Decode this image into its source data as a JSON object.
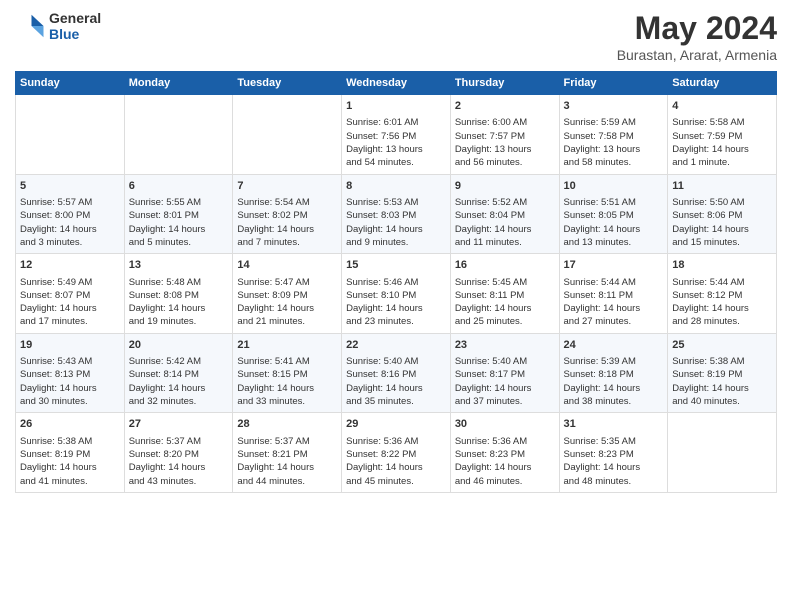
{
  "header": {
    "logo_general": "General",
    "logo_blue": "Blue",
    "title": "May 2024",
    "subtitle": "Burastan, Ararat, Armenia"
  },
  "calendar": {
    "days_of_week": [
      "Sunday",
      "Monday",
      "Tuesday",
      "Wednesday",
      "Thursday",
      "Friday",
      "Saturday"
    ],
    "weeks": [
      [
        {
          "day": "",
          "detail": ""
        },
        {
          "day": "",
          "detail": ""
        },
        {
          "day": "",
          "detail": ""
        },
        {
          "day": "1",
          "detail": "Sunrise: 6:01 AM\nSunset: 7:56 PM\nDaylight: 13 hours\nand 54 minutes."
        },
        {
          "day": "2",
          "detail": "Sunrise: 6:00 AM\nSunset: 7:57 PM\nDaylight: 13 hours\nand 56 minutes."
        },
        {
          "day": "3",
          "detail": "Sunrise: 5:59 AM\nSunset: 7:58 PM\nDaylight: 13 hours\nand 58 minutes."
        },
        {
          "day": "4",
          "detail": "Sunrise: 5:58 AM\nSunset: 7:59 PM\nDaylight: 14 hours\nand 1 minute."
        }
      ],
      [
        {
          "day": "5",
          "detail": "Sunrise: 5:57 AM\nSunset: 8:00 PM\nDaylight: 14 hours\nand 3 minutes."
        },
        {
          "day": "6",
          "detail": "Sunrise: 5:55 AM\nSunset: 8:01 PM\nDaylight: 14 hours\nand 5 minutes."
        },
        {
          "day": "7",
          "detail": "Sunrise: 5:54 AM\nSunset: 8:02 PM\nDaylight: 14 hours\nand 7 minutes."
        },
        {
          "day": "8",
          "detail": "Sunrise: 5:53 AM\nSunset: 8:03 PM\nDaylight: 14 hours\nand 9 minutes."
        },
        {
          "day": "9",
          "detail": "Sunrise: 5:52 AM\nSunset: 8:04 PM\nDaylight: 14 hours\nand 11 minutes."
        },
        {
          "day": "10",
          "detail": "Sunrise: 5:51 AM\nSunset: 8:05 PM\nDaylight: 14 hours\nand 13 minutes."
        },
        {
          "day": "11",
          "detail": "Sunrise: 5:50 AM\nSunset: 8:06 PM\nDaylight: 14 hours\nand 15 minutes."
        }
      ],
      [
        {
          "day": "12",
          "detail": "Sunrise: 5:49 AM\nSunset: 8:07 PM\nDaylight: 14 hours\nand 17 minutes."
        },
        {
          "day": "13",
          "detail": "Sunrise: 5:48 AM\nSunset: 8:08 PM\nDaylight: 14 hours\nand 19 minutes."
        },
        {
          "day": "14",
          "detail": "Sunrise: 5:47 AM\nSunset: 8:09 PM\nDaylight: 14 hours\nand 21 minutes."
        },
        {
          "day": "15",
          "detail": "Sunrise: 5:46 AM\nSunset: 8:10 PM\nDaylight: 14 hours\nand 23 minutes."
        },
        {
          "day": "16",
          "detail": "Sunrise: 5:45 AM\nSunset: 8:11 PM\nDaylight: 14 hours\nand 25 minutes."
        },
        {
          "day": "17",
          "detail": "Sunrise: 5:44 AM\nSunset: 8:11 PM\nDaylight: 14 hours\nand 27 minutes."
        },
        {
          "day": "18",
          "detail": "Sunrise: 5:44 AM\nSunset: 8:12 PM\nDaylight: 14 hours\nand 28 minutes."
        }
      ],
      [
        {
          "day": "19",
          "detail": "Sunrise: 5:43 AM\nSunset: 8:13 PM\nDaylight: 14 hours\nand 30 minutes."
        },
        {
          "day": "20",
          "detail": "Sunrise: 5:42 AM\nSunset: 8:14 PM\nDaylight: 14 hours\nand 32 minutes."
        },
        {
          "day": "21",
          "detail": "Sunrise: 5:41 AM\nSunset: 8:15 PM\nDaylight: 14 hours\nand 33 minutes."
        },
        {
          "day": "22",
          "detail": "Sunrise: 5:40 AM\nSunset: 8:16 PM\nDaylight: 14 hours\nand 35 minutes."
        },
        {
          "day": "23",
          "detail": "Sunrise: 5:40 AM\nSunset: 8:17 PM\nDaylight: 14 hours\nand 37 minutes."
        },
        {
          "day": "24",
          "detail": "Sunrise: 5:39 AM\nSunset: 8:18 PM\nDaylight: 14 hours\nand 38 minutes."
        },
        {
          "day": "25",
          "detail": "Sunrise: 5:38 AM\nSunset: 8:19 PM\nDaylight: 14 hours\nand 40 minutes."
        }
      ],
      [
        {
          "day": "26",
          "detail": "Sunrise: 5:38 AM\nSunset: 8:19 PM\nDaylight: 14 hours\nand 41 minutes."
        },
        {
          "day": "27",
          "detail": "Sunrise: 5:37 AM\nSunset: 8:20 PM\nDaylight: 14 hours\nand 43 minutes."
        },
        {
          "day": "28",
          "detail": "Sunrise: 5:37 AM\nSunset: 8:21 PM\nDaylight: 14 hours\nand 44 minutes."
        },
        {
          "day": "29",
          "detail": "Sunrise: 5:36 AM\nSunset: 8:22 PM\nDaylight: 14 hours\nand 45 minutes."
        },
        {
          "day": "30",
          "detail": "Sunrise: 5:36 AM\nSunset: 8:23 PM\nDaylight: 14 hours\nand 46 minutes."
        },
        {
          "day": "31",
          "detail": "Sunrise: 5:35 AM\nSunset: 8:23 PM\nDaylight: 14 hours\nand 48 minutes."
        },
        {
          "day": "",
          "detail": ""
        }
      ]
    ]
  }
}
